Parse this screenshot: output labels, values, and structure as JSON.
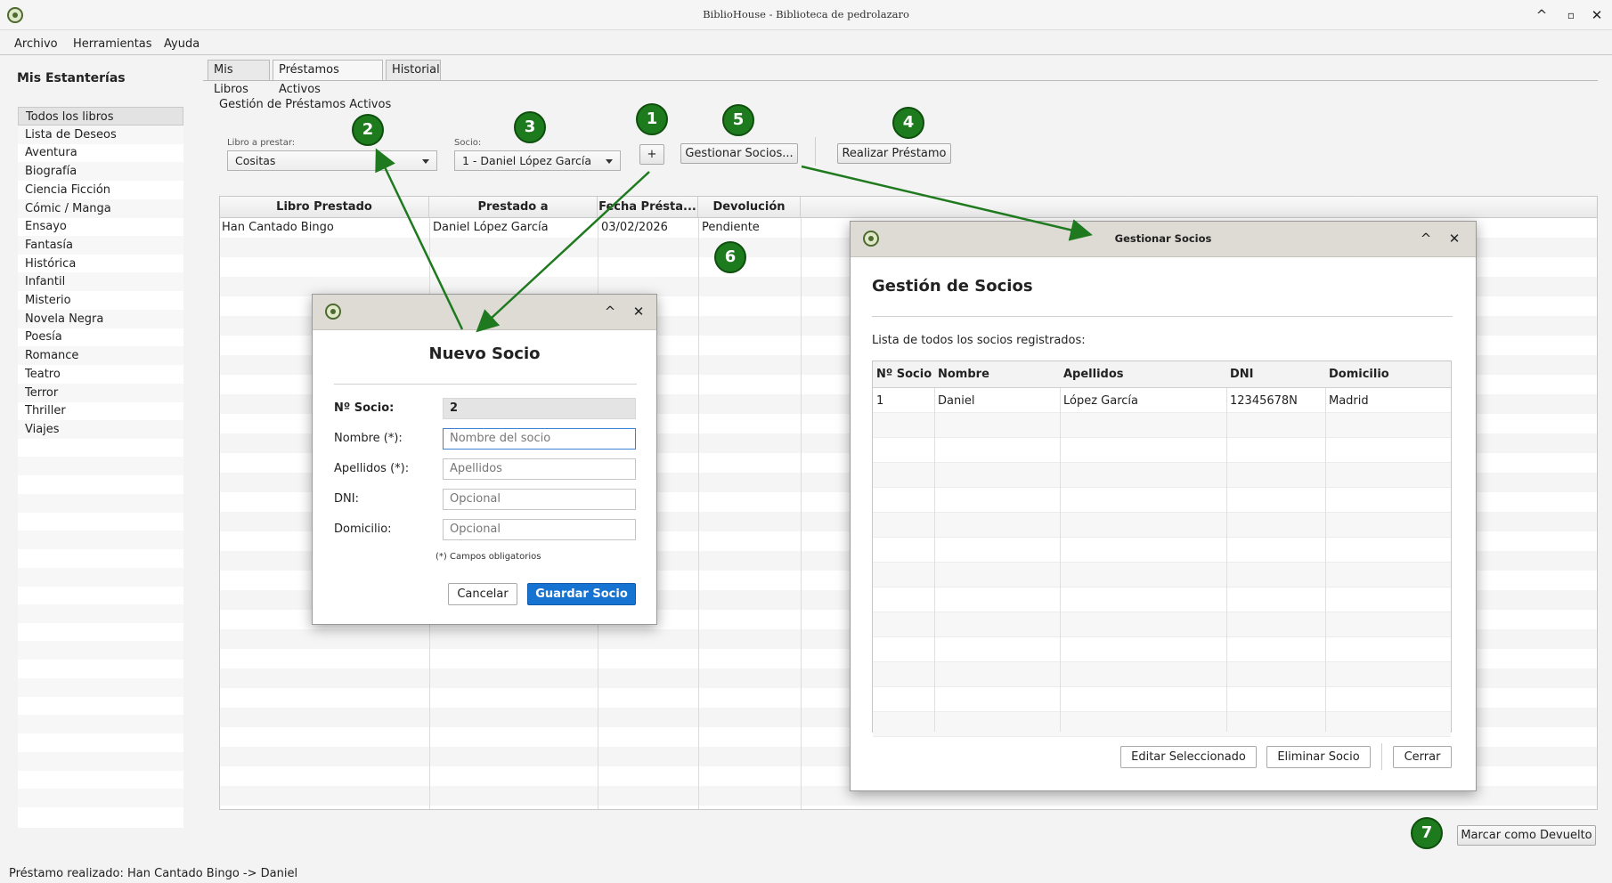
{
  "window": {
    "title": "BiblioHouse - Biblioteca de pedrolazaro",
    "minimize": "^",
    "maximize": "▫",
    "close": "✕"
  },
  "menu": [
    "Archivo",
    "Herramientas",
    "Ayuda"
  ],
  "sidebar": {
    "title": "Mis Estanterías",
    "items": [
      "Todos los libros",
      "Lista de Deseos",
      "Aventura",
      "Biografía",
      "Ciencia Ficción",
      "Cómic / Manga",
      "Ensayo",
      "Fantasía",
      "Histórica",
      "Infantil",
      "Misterio",
      "Novela Negra",
      "Poesía",
      "Romance",
      "Teatro",
      "Terror",
      "Thriller",
      "Viajes"
    ]
  },
  "tabs": [
    "Mis Libros",
    "Préstamos Activos",
    "Historial"
  ],
  "loans": {
    "section_title": "Gestión de Préstamos Activos",
    "book_label": "Libro a prestar:",
    "book_value": "Cositas",
    "member_label": "Socio:",
    "member_value": "1 - Daniel López García",
    "add_button": "+",
    "manage_button": "Gestionar Socios...",
    "loan_button": "Realizar Préstamo",
    "columns": [
      "Libro Prestado",
      "Prestado a",
      "Fecha Présta...",
      "Devolución"
    ],
    "rows": [
      [
        "Han Cantado Bingo",
        "Daniel López García",
        "03/02/2026",
        "Pendiente"
      ]
    ],
    "return_button": "Marcar como Devuelto"
  },
  "status": "Préstamo realizado: Han Cantado Bingo -> Daniel",
  "badges": [
    "1",
    "2",
    "3",
    "4",
    "5",
    "6",
    "7"
  ],
  "new_member_dialog": {
    "title": "Nuevo Socio",
    "number_label": "Nº Socio:",
    "number_value": "2",
    "name_label": "Nombre (*):",
    "name_placeholder": "Nombre del socio",
    "surname_label": "Apellidos (*):",
    "surname_placeholder": "Apellidos",
    "dni_label": "DNI:",
    "dni_placeholder": "Opcional",
    "address_label": "Domicilio:",
    "address_placeholder": "Opcional",
    "required_note": "(*) Campos obligatorios",
    "cancel": "Cancelar",
    "save": "Guardar Socio"
  },
  "members_dialog": {
    "window_title": "Gestionar Socios",
    "heading": "Gestión de Socios",
    "list_label": "Lista de todos los socios registrados:",
    "columns": [
      "Nº Socio",
      "Nombre",
      "Apellidos",
      "DNI",
      "Domicilio"
    ],
    "rows": [
      [
        "1",
        "Daniel",
        "López García",
        "12345678N",
        "Madrid"
      ]
    ],
    "edit": "Editar Seleccionado",
    "delete": "Eliminar Socio",
    "close": "Cerrar"
  },
  "colors": {
    "badge_green": "#1d7a1d",
    "arrow_green": "#1f7a1f",
    "primary_blue": "#1673d1"
  }
}
